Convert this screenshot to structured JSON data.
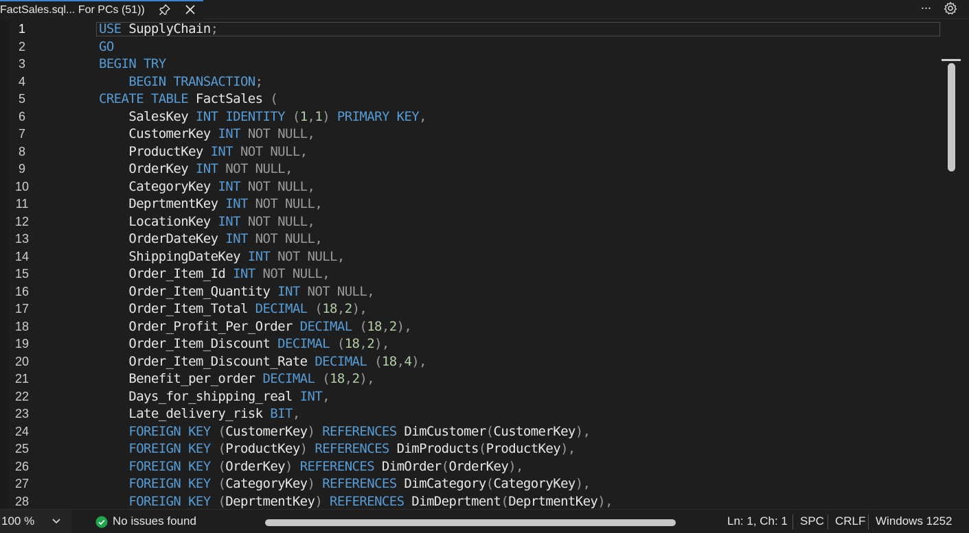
{
  "tab": {
    "title": "FactSales.sql... For PCs (51))",
    "pin_icon": "pin-icon",
    "close_icon": "close-icon"
  },
  "toolbar": {
    "more_label": "···",
    "settings_icon": "gear-icon"
  },
  "editor": {
    "current_line": 1,
    "lines": [
      {
        "n": "1",
        "t": [
          [
            "kw",
            "USE"
          ],
          [
            "id",
            " SupplyChain"
          ],
          [
            "gr",
            ";"
          ]
        ]
      },
      {
        "n": "2",
        "t": [
          [
            "kw",
            "GO"
          ]
        ]
      },
      {
        "n": "3",
        "t": [
          [
            "kw",
            "BEGIN TRY"
          ]
        ]
      },
      {
        "n": "4",
        "t": [
          [
            "id",
            "    "
          ],
          [
            "kw",
            "BEGIN TRANSACTION"
          ],
          [
            "gr",
            ";"
          ]
        ]
      },
      {
        "n": "5",
        "t": [
          [
            "kw",
            "CREATE TABLE"
          ],
          [
            "id",
            " FactSales "
          ],
          [
            "gr",
            "("
          ]
        ]
      },
      {
        "n": "6",
        "t": [
          [
            "id",
            "    SalesKey "
          ],
          [
            "kw",
            "INT IDENTITY"
          ],
          [
            "id",
            " "
          ],
          [
            "gr",
            "("
          ],
          [
            "nm",
            "1"
          ],
          [
            "gr",
            ","
          ],
          [
            "nm",
            "1"
          ],
          [
            "gr",
            ")"
          ],
          [
            "id",
            " "
          ],
          [
            "kw",
            "PRIMARY KEY"
          ],
          [
            "gr",
            ","
          ]
        ]
      },
      {
        "n": "7",
        "t": [
          [
            "id",
            "    CustomerKey "
          ],
          [
            "kw",
            "INT"
          ],
          [
            "id",
            " "
          ],
          [
            "gr",
            "NOT NULL,"
          ]
        ]
      },
      {
        "n": "8",
        "t": [
          [
            "id",
            "    ProductKey "
          ],
          [
            "kw",
            "INT"
          ],
          [
            "id",
            " "
          ],
          [
            "gr",
            "NOT NULL,"
          ]
        ]
      },
      {
        "n": "9",
        "t": [
          [
            "id",
            "    OrderKey "
          ],
          [
            "kw",
            "INT"
          ],
          [
            "id",
            " "
          ],
          [
            "gr",
            "NOT NULL,"
          ]
        ]
      },
      {
        "n": "10",
        "t": [
          [
            "id",
            "    CategoryKey "
          ],
          [
            "kw",
            "INT"
          ],
          [
            "id",
            " "
          ],
          [
            "gr",
            "NOT NULL,"
          ]
        ]
      },
      {
        "n": "11",
        "t": [
          [
            "id",
            "    DeprtmentKey "
          ],
          [
            "kw",
            "INT"
          ],
          [
            "id",
            " "
          ],
          [
            "gr",
            "NOT NULL,"
          ]
        ]
      },
      {
        "n": "12",
        "t": [
          [
            "id",
            "    LocationKey "
          ],
          [
            "kw",
            "INT"
          ],
          [
            "id",
            " "
          ],
          [
            "gr",
            "NOT NULL,"
          ]
        ]
      },
      {
        "n": "13",
        "t": [
          [
            "id",
            "    OrderDateKey "
          ],
          [
            "kw",
            "INT"
          ],
          [
            "id",
            " "
          ],
          [
            "gr",
            "NOT NULL,"
          ]
        ]
      },
      {
        "n": "14",
        "t": [
          [
            "id",
            "    ShippingDateKey "
          ],
          [
            "kw",
            "INT"
          ],
          [
            "id",
            " "
          ],
          [
            "gr",
            "NOT NULL,"
          ]
        ]
      },
      {
        "n": "15",
        "t": [
          [
            "id",
            "    Order_Item_Id "
          ],
          [
            "kw",
            "INT"
          ],
          [
            "id",
            " "
          ],
          [
            "gr",
            "NOT NULL,"
          ]
        ]
      },
      {
        "n": "16",
        "t": [
          [
            "id",
            "    Order_Item_Quantity "
          ],
          [
            "kw",
            "INT"
          ],
          [
            "id",
            " "
          ],
          [
            "gr",
            "NOT NULL,"
          ]
        ]
      },
      {
        "n": "17",
        "t": [
          [
            "id",
            "    Order_Item_Total "
          ],
          [
            "kw",
            "DECIMAL"
          ],
          [
            "id",
            " "
          ],
          [
            "gr",
            "("
          ],
          [
            "nm",
            "18"
          ],
          [
            "gr",
            ","
          ],
          [
            "nm",
            "2"
          ],
          [
            "gr",
            "),"
          ]
        ]
      },
      {
        "n": "18",
        "t": [
          [
            "id",
            "    Order_Profit_Per_Order "
          ],
          [
            "kw",
            "DECIMAL"
          ],
          [
            "id",
            " "
          ],
          [
            "gr",
            "("
          ],
          [
            "nm",
            "18"
          ],
          [
            "gr",
            ","
          ],
          [
            "nm",
            "2"
          ],
          [
            "gr",
            "),"
          ]
        ]
      },
      {
        "n": "19",
        "t": [
          [
            "id",
            "    Order_Item_Discount "
          ],
          [
            "kw",
            "DECIMAL"
          ],
          [
            "id",
            " "
          ],
          [
            "gr",
            "("
          ],
          [
            "nm",
            "18"
          ],
          [
            "gr",
            ","
          ],
          [
            "nm",
            "2"
          ],
          [
            "gr",
            "),"
          ]
        ]
      },
      {
        "n": "20",
        "t": [
          [
            "id",
            "    Order_Item_Discount_Rate "
          ],
          [
            "kw",
            "DECIMAL"
          ],
          [
            "id",
            " "
          ],
          [
            "gr",
            "("
          ],
          [
            "nm",
            "18"
          ],
          [
            "gr",
            ","
          ],
          [
            "nm",
            "4"
          ],
          [
            "gr",
            "),"
          ]
        ]
      },
      {
        "n": "21",
        "t": [
          [
            "id",
            "    Benefit_per_order "
          ],
          [
            "kw",
            "DECIMAL"
          ],
          [
            "id",
            " "
          ],
          [
            "gr",
            "("
          ],
          [
            "nm",
            "18"
          ],
          [
            "gr",
            ","
          ],
          [
            "nm",
            "2"
          ],
          [
            "gr",
            "),"
          ]
        ]
      },
      {
        "n": "22",
        "t": [
          [
            "id",
            "    Days_for_shipping_real "
          ],
          [
            "kw",
            "INT"
          ],
          [
            "gr",
            ","
          ]
        ]
      },
      {
        "n": "23",
        "t": [
          [
            "id",
            "    Late_delivery_risk "
          ],
          [
            "kw",
            "BIT"
          ],
          [
            "gr",
            ","
          ]
        ]
      },
      {
        "n": "24",
        "t": [
          [
            "id",
            "    "
          ],
          [
            "kw",
            "FOREIGN KEY"
          ],
          [
            "id",
            " "
          ],
          [
            "gr",
            "("
          ],
          [
            "id",
            "CustomerKey"
          ],
          [
            "gr",
            ")"
          ],
          [
            "id",
            " "
          ],
          [
            "kw",
            "REFERENCES"
          ],
          [
            "id",
            " DimCustomer"
          ],
          [
            "gr",
            "("
          ],
          [
            "id",
            "CustomerKey"
          ],
          [
            "gr",
            "),"
          ]
        ]
      },
      {
        "n": "25",
        "t": [
          [
            "id",
            "    "
          ],
          [
            "kw",
            "FOREIGN KEY"
          ],
          [
            "id",
            " "
          ],
          [
            "gr",
            "("
          ],
          [
            "id",
            "ProductKey"
          ],
          [
            "gr",
            ")"
          ],
          [
            "id",
            " "
          ],
          [
            "kw",
            "REFERENCES"
          ],
          [
            "id",
            " DimProducts"
          ],
          [
            "gr",
            "("
          ],
          [
            "id",
            "ProductKey"
          ],
          [
            "gr",
            "),"
          ]
        ]
      },
      {
        "n": "26",
        "t": [
          [
            "id",
            "    "
          ],
          [
            "kw",
            "FOREIGN KEY"
          ],
          [
            "id",
            " "
          ],
          [
            "gr",
            "("
          ],
          [
            "id",
            "OrderKey"
          ],
          [
            "gr",
            ")"
          ],
          [
            "id",
            " "
          ],
          [
            "kw",
            "REFERENCES"
          ],
          [
            "id",
            " DimOrder"
          ],
          [
            "gr",
            "("
          ],
          [
            "id",
            "OrderKey"
          ],
          [
            "gr",
            "),"
          ]
        ]
      },
      {
        "n": "27",
        "t": [
          [
            "id",
            "    "
          ],
          [
            "kw",
            "FOREIGN KEY"
          ],
          [
            "id",
            " "
          ],
          [
            "gr",
            "("
          ],
          [
            "id",
            "CategoryKey"
          ],
          [
            "gr",
            ")"
          ],
          [
            "id",
            " "
          ],
          [
            "kw",
            "REFERENCES"
          ],
          [
            "id",
            " DimCategory"
          ],
          [
            "gr",
            "("
          ],
          [
            "id",
            "CategoryKey"
          ],
          [
            "gr",
            "),"
          ]
        ]
      },
      {
        "n": "28",
        "t": [
          [
            "id",
            "    "
          ],
          [
            "kw",
            "FOREIGN KEY"
          ],
          [
            "id",
            " "
          ],
          [
            "gr",
            "("
          ],
          [
            "id",
            "DeprtmentKey"
          ],
          [
            "gr",
            ")"
          ],
          [
            "id",
            " "
          ],
          [
            "kw",
            "REFERENCES"
          ],
          [
            "id",
            " DimDeprtment"
          ],
          [
            "gr",
            "("
          ],
          [
            "id",
            "DeprtmentKey"
          ],
          [
            "gr",
            "),"
          ]
        ]
      }
    ]
  },
  "statusbar": {
    "zoom": "100 %",
    "issues": "No issues found",
    "position": "Ln: 1, Ch: 1",
    "whitespace": "SPC",
    "line_ending": "CRLF",
    "encoding": "Windows 1252"
  },
  "colors": {
    "keyword": "#569cd6",
    "operator": "#9b9b9b",
    "number": "#b5cea8",
    "identifier": "#e8e8e8",
    "ok_status": "#1fa54a"
  }
}
